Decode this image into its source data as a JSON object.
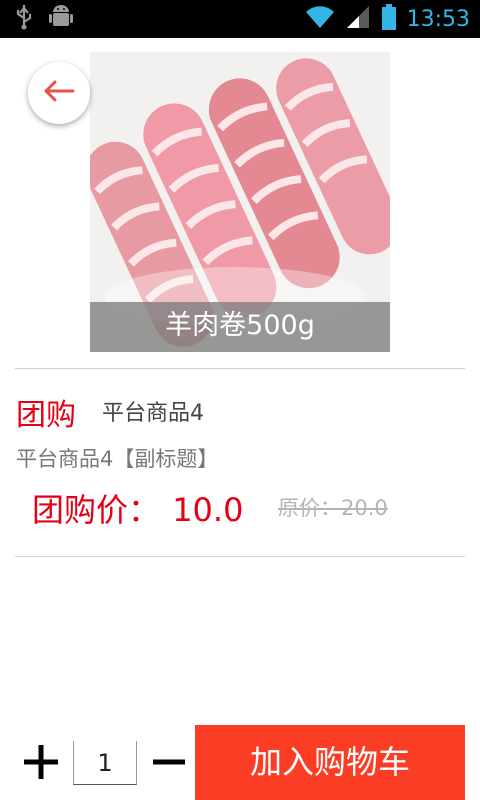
{
  "status_bar": {
    "time": "13:53",
    "icons": [
      "usb-icon",
      "android-debug-icon",
      "wifi-icon",
      "signal-icon",
      "battery-icon"
    ]
  },
  "product": {
    "image_caption": "羊肉卷500g",
    "tag": "团购",
    "name": "平台商品4",
    "subtitle": "平台商品4【副标题】",
    "group_price_label": "团购价：",
    "group_price": "10.0",
    "original_price": "原价：20.0"
  },
  "actions": {
    "back_icon": "arrow-left-icon",
    "plus_icon": "plus-icon",
    "minus_icon": "minus-icon",
    "quantity": "1",
    "add_to_cart": "加入购物车"
  },
  "colors": {
    "accent": "#e60012",
    "cart_button": "#fb3d26",
    "status_time": "#33b5e5"
  }
}
